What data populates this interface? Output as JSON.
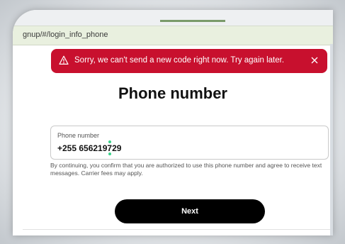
{
  "browser": {
    "url": "gnup/#/login_info_phone"
  },
  "alert": {
    "message": "Sorry, we can't send a new code right now. Try again later.",
    "icon": "warning-icon",
    "close_icon": "close-icon",
    "color": "#c8102e"
  },
  "page": {
    "title": "Phone number"
  },
  "phone_field": {
    "label": "Phone number",
    "value": "+255 656219729"
  },
  "disclaimer": "By continuing, you confirm that you are authorized to use this phone number and agree to receive text messages. Carrier fees may apply.",
  "next_button": {
    "label": "Next"
  }
}
